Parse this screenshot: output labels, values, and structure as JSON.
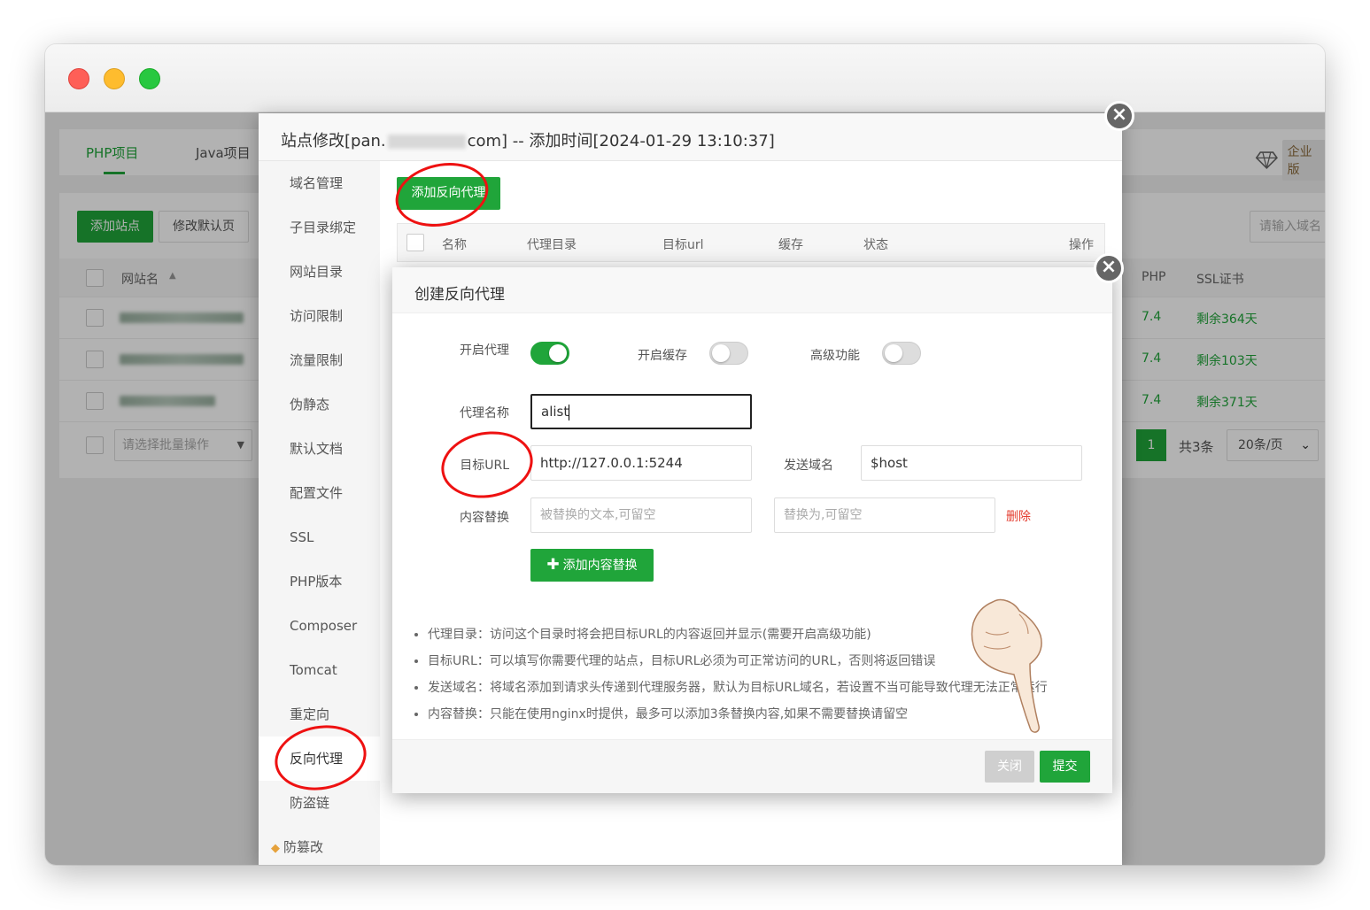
{
  "tabs": [
    "PHP项目",
    "Java项目"
  ],
  "enterprise": {
    "label": "企业版",
    "icon": "diamond-icon"
  },
  "toolbar": {
    "add_site": "添加站点",
    "edit_default": "修改默认页",
    "search_placeholder": "请输入域名"
  },
  "table": {
    "headers": {
      "name": "网站名",
      "php": "PHP",
      "ssl": "SSL证书"
    },
    "rows": [
      {
        "php": "7.4",
        "ssl": "剩余364天"
      },
      {
        "php": "7.4",
        "ssl": "剩余103天"
      },
      {
        "php": "7.4",
        "ssl": "剩余371天"
      }
    ],
    "batch_placeholder": "请选择批量操作"
  },
  "pagination": {
    "page": "1",
    "total": "共3条",
    "per_page": "20条/页"
  },
  "site_dialog": {
    "title_prefix": "站点修改[pan.",
    "title_suffix": "com] -- 添加时间[2024-01-29 13:10:37]",
    "menu": [
      "域名管理",
      "子目录绑定",
      "网站目录",
      "访问限制",
      "流量限制",
      "伪静态",
      "默认文档",
      "配置文件",
      "SSL",
      "PHP版本",
      "Composer",
      "Tomcat",
      "重定向",
      "反向代理",
      "防盗链",
      "防篡改"
    ],
    "active_menu": "反向代理",
    "add_proxy_button": "添加反向代理",
    "columns": [
      "名称",
      "代理目录",
      "目标url",
      "缓存",
      "状态",
      "操作"
    ]
  },
  "proxy_dialog": {
    "title": "创建反向代理",
    "enable_proxy_label": "开启代理",
    "enable_proxy": true,
    "enable_cache_label": "开启缓存",
    "enable_cache": false,
    "advanced_label": "高级功能",
    "advanced": false,
    "proxy_name_label": "代理名称",
    "proxy_name_value": "alist",
    "target_url_label": "目标URL",
    "target_url_value": "http://127.0.0.1:5244",
    "send_domain_label": "发送域名",
    "send_domain_value": "$host",
    "replace_label": "内容替换",
    "replace_from_placeholder": "被替换的文本,可留空",
    "replace_to_placeholder": "替换为,可留空",
    "delete_label": "删除",
    "add_replace_button": "添加内容替换",
    "tips": [
      "代理目录：访问这个目录时将会把目标URL的内容返回并显示(需要开启高级功能)",
      "目标URL：可以填写你需要代理的站点，目标URL必须为可正常访问的URL，否则将返回错误",
      "发送域名：将域名添加到请求头传递到代理服务器，默认为目标URL域名，若设置不当可能导致代理无法正常运行",
      "内容替换：只能在使用nginx时提供，最多可以添加3条替换内容,如果不需要替换请留空"
    ],
    "close_button": "关闭",
    "submit_button": "提交"
  },
  "colors": {
    "primary": "#20a53a",
    "danger": "#e43d30",
    "annotation": "#e11111"
  }
}
